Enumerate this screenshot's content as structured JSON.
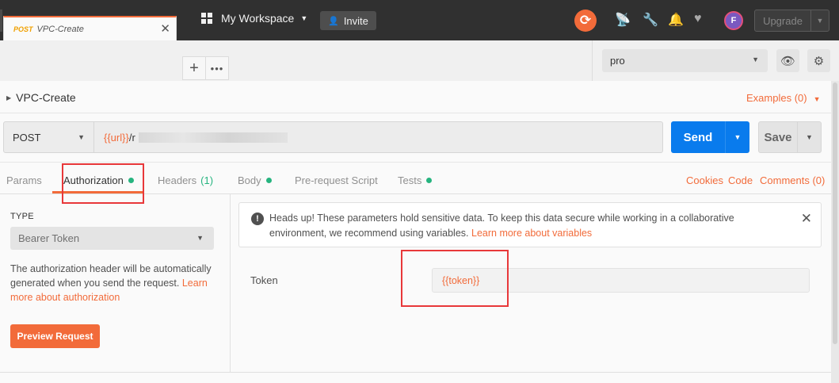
{
  "header": {
    "workspace_label": "My Workspace",
    "invite_label": "Invite",
    "upgrade_label": "Upgrade",
    "avatar_initial": "F"
  },
  "tabs": {
    "active": {
      "method": "POST",
      "name": "VPC-Create"
    }
  },
  "environment": {
    "selected": "pro"
  },
  "request": {
    "title": "VPC-Create",
    "examples_label": "Examples (0)",
    "method": "POST",
    "url_var": "{{url}}",
    "url_path": "/r",
    "send_label": "Send",
    "save_label": "Save"
  },
  "subtabs": {
    "params": "Params",
    "authorization": "Authorization",
    "headers": "Headers",
    "headers_count": "(1)",
    "body": "Body",
    "prerequest": "Pre-request Script",
    "tests": "Tests",
    "cookies": "Cookies",
    "code": "Code",
    "comments": "Comments (0)"
  },
  "auth": {
    "type_label": "TYPE",
    "type_value": "Bearer Token",
    "desc_text": "The authorization header will be automatically generated when you send the request.",
    "desc_link": "Learn more about authorization",
    "preview_label": "Preview Request"
  },
  "notice": {
    "text": "Heads up! These parameters hold sensitive data. To keep this data secure while working in a collaborative environment, we recommend using variables.",
    "link": "Learn more about variables"
  },
  "token": {
    "label": "Token",
    "value": "{{token}}"
  },
  "colors": {
    "accent": "#f26b3a",
    "send": "#097bed",
    "status_green": "#26b47f",
    "annotation_red": "#e8383a"
  }
}
